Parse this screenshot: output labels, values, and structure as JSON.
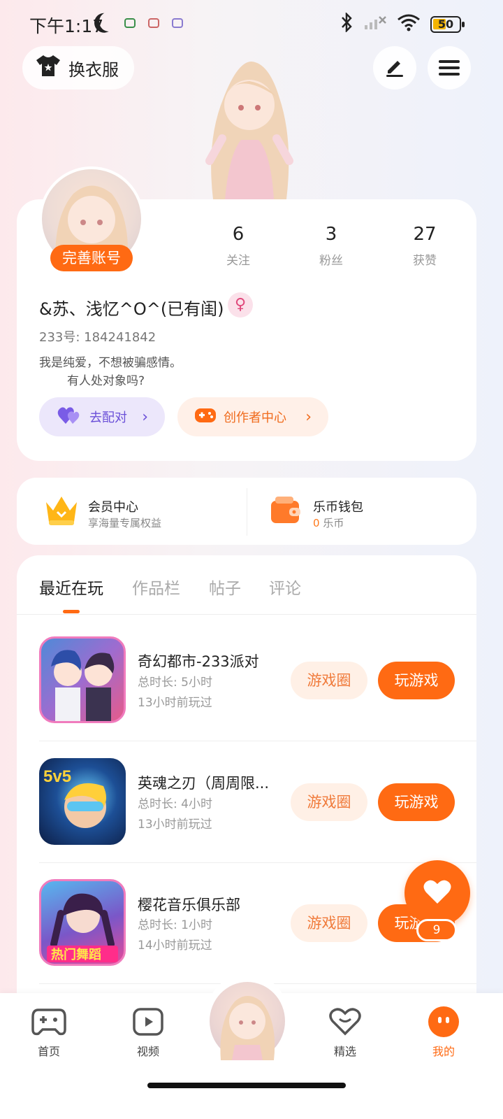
{
  "status_bar": {
    "time": "下午1:17",
    "battery": "50"
  },
  "header": {
    "dress_label": "换衣服"
  },
  "profile": {
    "complete_label": "完善账号",
    "stats": [
      {
        "num": "6",
        "label": "关注"
      },
      {
        "num": "3",
        "label": "粉丝"
      },
      {
        "num": "27",
        "label": "获赞"
      }
    ],
    "nickname": "&苏、浅忆^O^(已有闺)",
    "uid": "233号: 184241842",
    "bio_line1": "我是纯爱，不想被骗感情。",
    "bio_line2": "有人处对象吗?",
    "match_label": "去配对",
    "creator_label": "创作者中心"
  },
  "member": {
    "title": "会员中心",
    "subtitle": "享海量专属权益",
    "wallet_title": "乐币钱包",
    "wallet_amount": "0",
    "wallet_unit": "乐币"
  },
  "tabs": [
    "最近在玩",
    "作品栏",
    "帖子",
    "评论"
  ],
  "games": [
    {
      "title": "奇幻都市-233派对",
      "duration": "总时长: 5小时",
      "last_played": "13小时前玩过"
    },
    {
      "title": "英魂之刃（周周限...",
      "duration": "总时长: 4小时",
      "last_played": "13小时前玩过"
    },
    {
      "title": "樱花音乐俱乐部",
      "duration": "总时长: 1小时",
      "last_played": "14小时前玩过"
    }
  ],
  "game_buttons": {
    "circle": "游戏圈",
    "play": "玩游戏"
  },
  "fab_badge": "9",
  "nav": [
    {
      "label": "首页"
    },
    {
      "label": "视频"
    },
    {
      "label": "精选"
    },
    {
      "label": "我的"
    }
  ],
  "colors": {
    "accent": "#ff6a13",
    "match": "#6a4fd8"
  }
}
